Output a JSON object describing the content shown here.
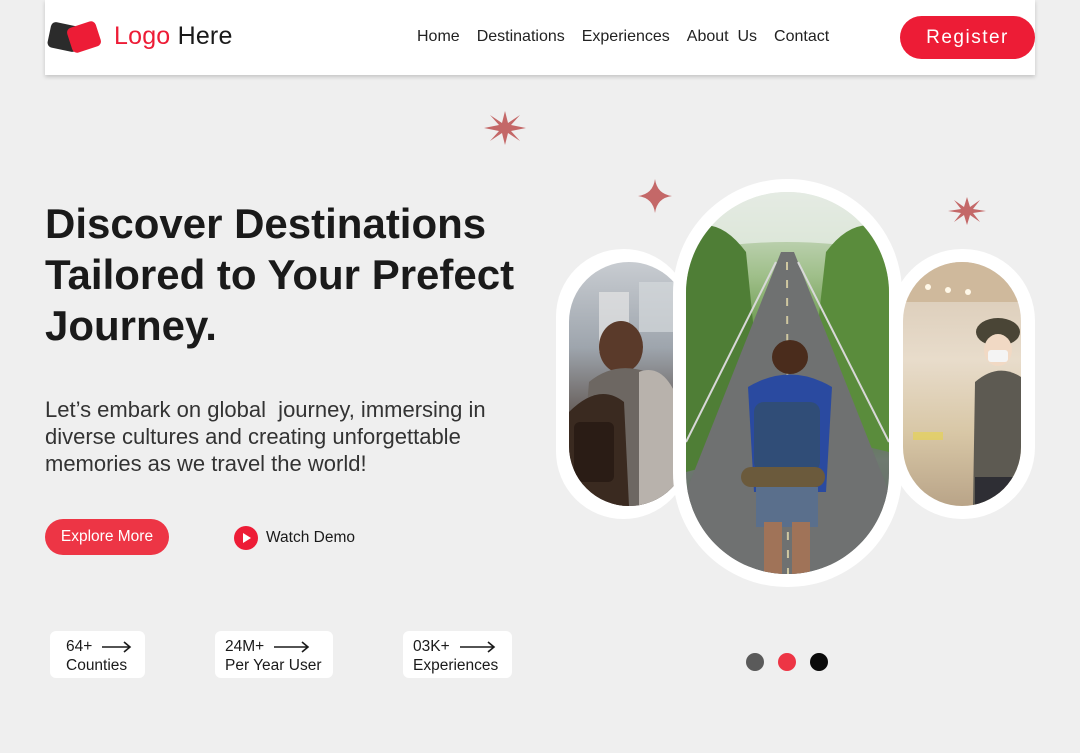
{
  "brand": {
    "logo_accent": "Logo",
    "logo_rest": " Here",
    "accent_color": "#ed1c36"
  },
  "nav": {
    "items": [
      {
        "label": "Home"
      },
      {
        "label": "Destinations"
      },
      {
        "label": "Experiences"
      },
      {
        "label": "About  Us"
      },
      {
        "label": "Contact"
      }
    ],
    "register_label": "Register"
  },
  "hero": {
    "title_lines": [
      "Discover Destinations",
      "Tailored to Your Prefect",
      "Journey."
    ],
    "description_lines": [
      "Let’s embark on global  journey, immersing in",
      "diverse cultures and creating unforgettable",
      "memories as we travel the world!"
    ],
    "explore_label": "Explore More",
    "watch_demo_label": "Watch Demo"
  },
  "stats": [
    {
      "value": "64+",
      "label": "Counties"
    },
    {
      "value": "24M+",
      "label": "Per Year User"
    },
    {
      "value": "03K+",
      "label": "Experiences"
    }
  ],
  "carousel": {
    "dot_colors": [
      "#5a5a5a",
      "#ed3545",
      "#0a0a0a"
    ],
    "active_index": 1
  },
  "icons": {
    "play": "play-icon",
    "arrow": "arrow-right-icon",
    "star": "star-icon"
  }
}
